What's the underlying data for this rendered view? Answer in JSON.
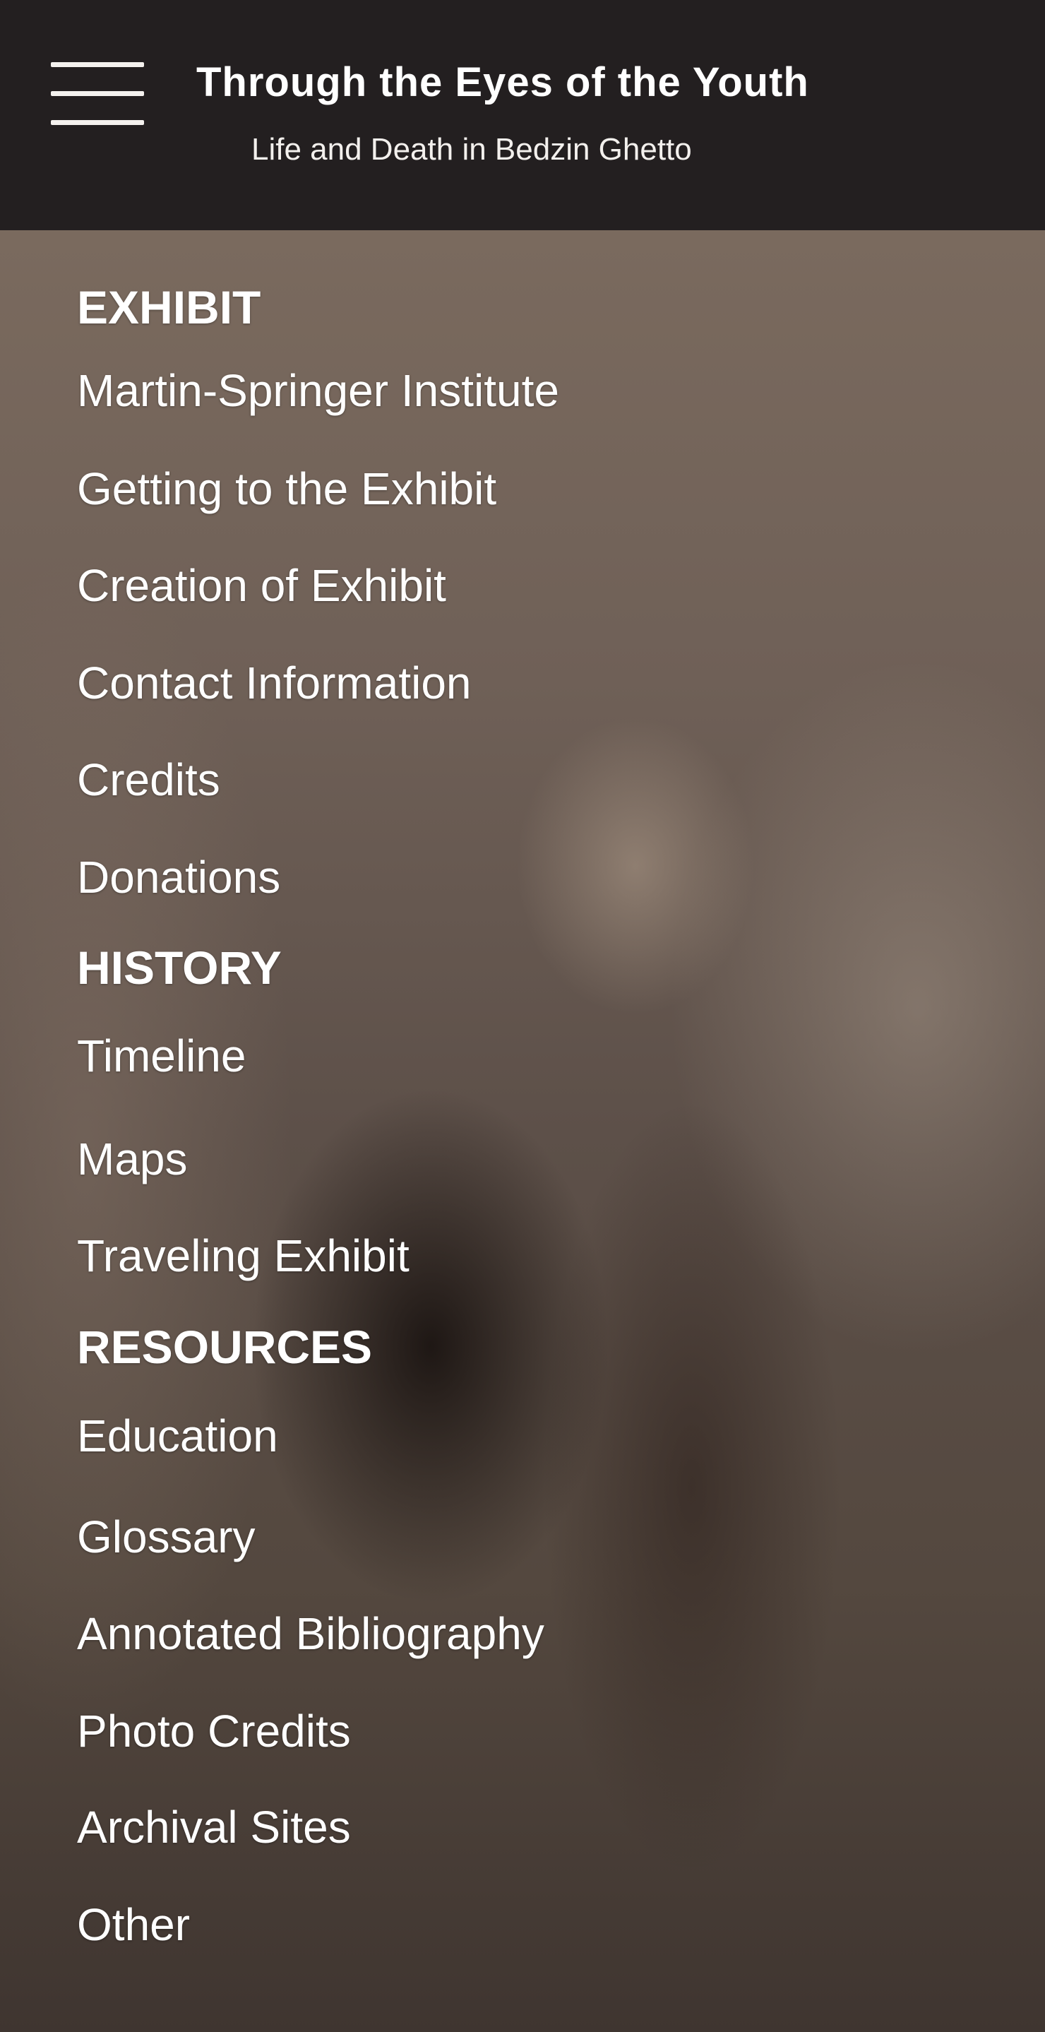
{
  "header": {
    "title": "Through the Eyes of the Youth",
    "subtitle": "Life and Death in Bedzin Ghetto",
    "menu_icon": "hamburger-menu-icon"
  },
  "menu": {
    "sections": [
      {
        "heading": "EXHIBIT",
        "items": [
          "Martin-Springer Institute",
          "Getting to the Exhibit",
          "Creation of Exhibit",
          "Contact Information",
          "Credits",
          "Donations"
        ]
      },
      {
        "heading": "HISTORY",
        "items": [
          "Timeline",
          "Maps",
          "Traveling Exhibit"
        ]
      },
      {
        "heading": "RESOURCES",
        "items": [
          "Education",
          "Glossary",
          "Annotated Bibliography",
          "Photo Credits",
          "Archival Sites",
          "Other"
        ]
      }
    ]
  },
  "colors": {
    "header_background": "#231f20",
    "text": "#ffffff"
  }
}
